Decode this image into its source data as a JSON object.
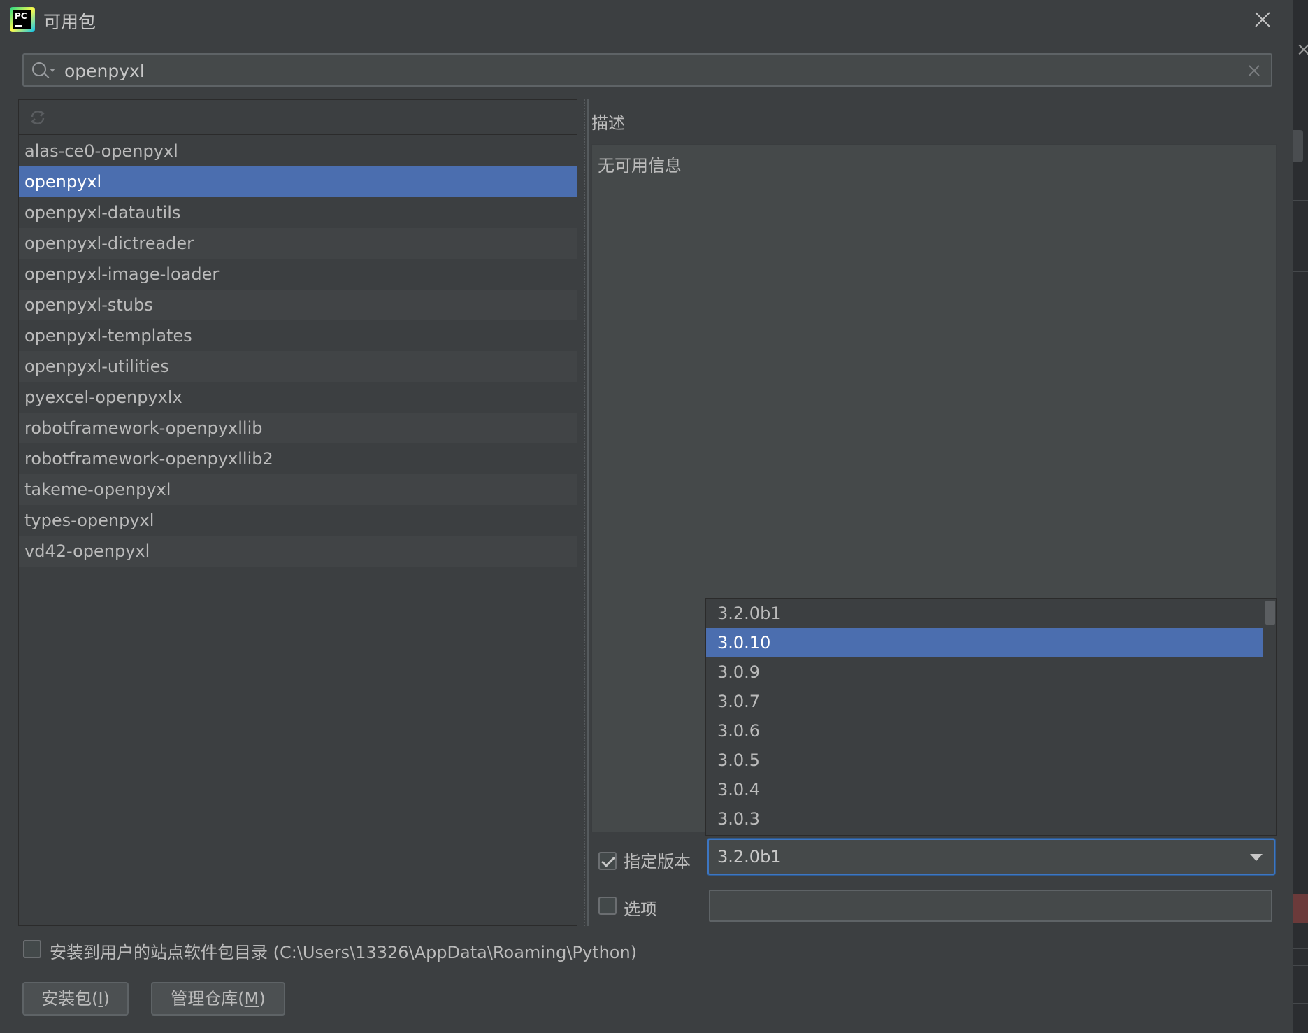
{
  "window": {
    "title": "可用包",
    "logo_text": "PC"
  },
  "search": {
    "value": "openpyxl",
    "placeholder": ""
  },
  "packages": [
    "alas-ce0-openpyxl",
    "openpyxl",
    "openpyxl-datautils",
    "openpyxl-dictreader",
    "openpyxl-image-loader",
    "openpyxl-stubs",
    "openpyxl-templates",
    "openpyxl-utilities",
    "pyexcel-openpyxlx",
    "robotframework-openpyxllib",
    "robotframework-openpyxllib2",
    "takeme-openpyxl",
    "types-openpyxl",
    "vd42-openpyxl"
  ],
  "selected_package": "openpyxl",
  "description": {
    "label": "描述",
    "text": "无可用信息"
  },
  "version_popup": {
    "options": [
      "3.2.0b1",
      "3.0.10",
      "3.0.9",
      "3.0.7",
      "3.0.6",
      "3.0.5",
      "3.0.4",
      "3.0.3"
    ],
    "highlighted": "3.0.10"
  },
  "specify_version": {
    "label": "指定版本",
    "checked": true,
    "value": "3.2.0b1"
  },
  "options_field": {
    "label": "选项",
    "checked": false,
    "value": ""
  },
  "install_user": {
    "label": "安装到用户的站点软件包目录 (C:\\Users\\13326\\AppData\\Roaming\\Python)",
    "checked": false
  },
  "buttons": {
    "install": {
      "text": "安装包(",
      "mnemonic": "I",
      "suffix": ")"
    },
    "manage": {
      "text": "管理仓库(",
      "mnemonic": "M",
      "suffix": ")"
    }
  },
  "colors": {
    "background": "#3c3f41",
    "selection": "#4b6eaf",
    "focus": "#3d76c2"
  }
}
